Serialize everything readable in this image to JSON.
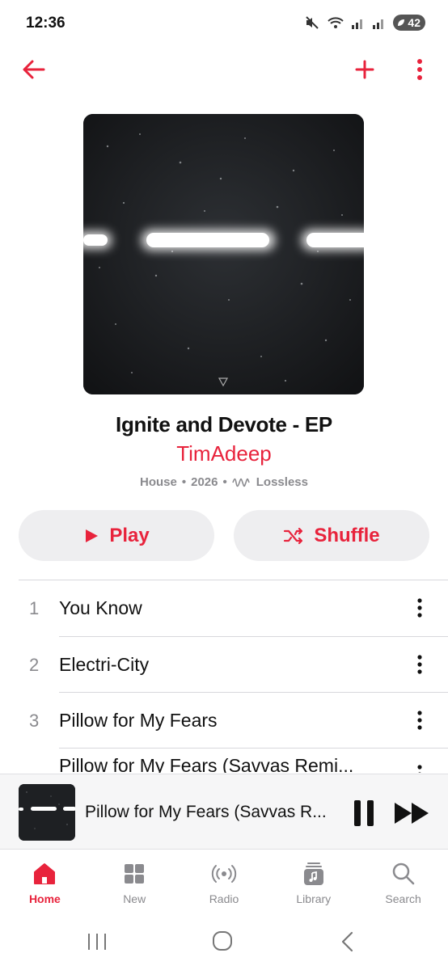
{
  "status_bar": {
    "time": "12:36",
    "battery": "42"
  },
  "album": {
    "title": "Ignite and Devote - EP",
    "artist": "TimAdeep",
    "genre": "House",
    "year": "2026",
    "quality": "Lossless",
    "separator": "•"
  },
  "actions": {
    "play_label": "Play",
    "shuffle_label": "Shuffle"
  },
  "tracks": [
    {
      "number": "1",
      "title": "You Know"
    },
    {
      "number": "2",
      "title": "Electri-City"
    },
    {
      "number": "3",
      "title": "Pillow for My Fears"
    },
    {
      "number": "",
      "title": "Pillow for My Fears (Savvas Remi..."
    }
  ],
  "mini_player": {
    "title": "Pillow for My Fears (Savvas R..."
  },
  "tabs": [
    {
      "label": "Home",
      "icon": "home-icon",
      "active": true
    },
    {
      "label": "New",
      "icon": "grid-icon",
      "active": false
    },
    {
      "label": "Radio",
      "icon": "radio-icon",
      "active": false
    },
    {
      "label": "Library",
      "icon": "library-icon",
      "active": false
    },
    {
      "label": "Search",
      "icon": "search-icon",
      "active": false
    }
  ],
  "colors": {
    "accent": "#e8233c",
    "secondary_text": "#8a8a8e",
    "pill_bg": "#eeeef0"
  }
}
